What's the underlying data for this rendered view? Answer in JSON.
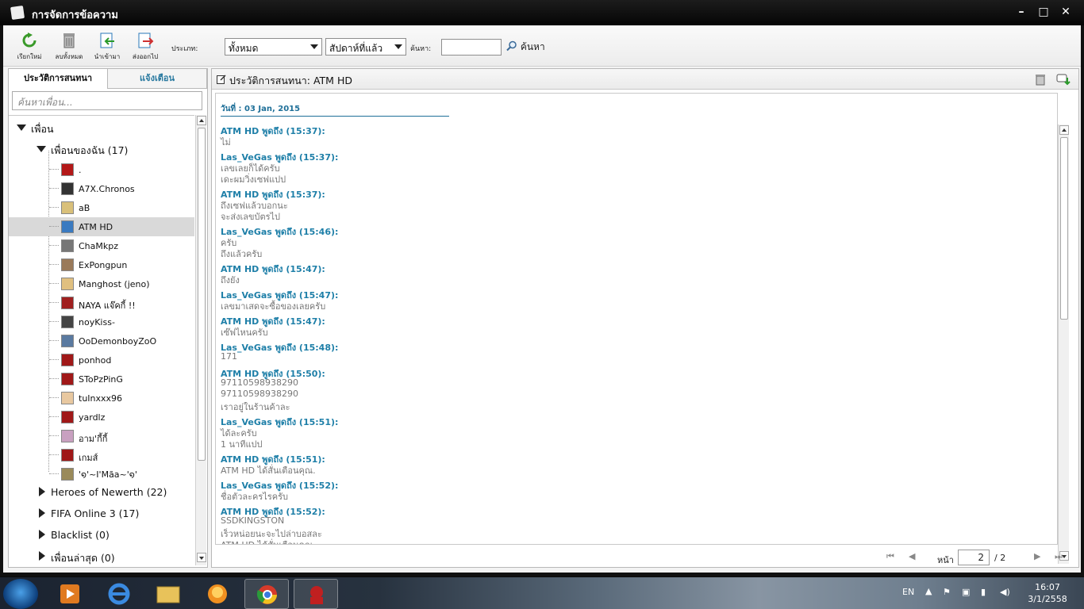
{
  "window": {
    "title": "การจัดการข้อความ"
  },
  "toolbar": {
    "buttons": [
      {
        "label": "เรียกใหม่"
      },
      {
        "label": "ลบทั้งหมด"
      },
      {
        "label": "นำเข้ามา"
      },
      {
        "label": "ส่งออกไป"
      }
    ],
    "type_label": "ประเภท:",
    "type_value": "ทั้งหมด",
    "period_value": "สัปดาห์ที่แล้ว",
    "search_label": "ค้นหา:",
    "search_button": "ค้นหา"
  },
  "left": {
    "tabs": [
      "ประวัติการสนทนา",
      "แจ้งเตือน"
    ],
    "search_placeholder": "ค้นหาเพื่อน...",
    "root": "เพื่อน",
    "my_friends": "เพื่อนของฉัน (17)",
    "friends": [
      ".",
      "A7X.Chronos",
      "aB",
      "ATM HD",
      "ChaMkpz",
      "ExPongpun",
      "Manghost (jeno)",
      "NAYA แจ๊คกี้ !!",
      "noyKiss-",
      "OoDemonboyZoO",
      "ponhod",
      "SToPzPinG",
      "tuInxxx96",
      "yardlz",
      "อาม'กี้กี้",
      "เกมส์",
      "'໑'~I'Mãa~'໑'"
    ],
    "selected_friend": "ATM HD",
    "groups": [
      "Heroes of Newerth (22)",
      "FIFA Online 3 (17)",
      "Blacklist (0)",
      "เพื่อนล่าสุด (0)"
    ]
  },
  "right": {
    "header": "ประวัติการสนทนา: ATM HD",
    "date": "วันที่ : 03 Jan, 2015",
    "messages": [
      {
        "head": "ATM HD พูดถึง  (15:37):",
        "lines": [
          "ไม่"
        ]
      },
      {
        "head": "Las_VeGas พูดถึง  (15:37):",
        "lines": [
          "เลขเลยก็ได้ครับ",
          "เดะผมวิ่งเซฟแปป"
        ]
      },
      {
        "head": "ATM HD พูดถึง  (15:37):",
        "lines": [
          "ถึงเซฟแล้วบอกนะ",
          "จะส่งเลขบัตรไป"
        ]
      },
      {
        "head": "Las_VeGas พูดถึง  (15:46):",
        "lines": [
          "ครับ",
          "ถึงแล้วครับ"
        ]
      },
      {
        "head": "ATM HD พูดถึง  (15:47):",
        "lines": [
          "ถึงยัง"
        ]
      },
      {
        "head": "Las_VeGas พูดถึง  (15:47):",
        "lines": [
          "เลขมาเสดจะซื้อของเลยครับ"
        ]
      },
      {
        "head": "ATM HD พูดถึง  (15:47):",
        "lines": [
          "เซ๊ฟไหนครับ"
        ]
      },
      {
        "head": "Las_VeGas พูดถึง  (15:48):",
        "lines": [
          "171"
        ]
      },
      {
        "head": "ATM HD พูดถึง  (15:50):",
        "lines": [
          "97110598938290",
          "97110598938290",
          "เราอยู่ในร้านค้าละ"
        ]
      },
      {
        "head": "Las_VeGas พูดถึง  (15:51):",
        "lines": [
          "ได้ละครับ",
          "1 นาทีแปป"
        ]
      },
      {
        "head": "ATM HD พูดถึง  (15:51):",
        "lines": [
          "ATM HD ได้สั่นเตือนคุณ."
        ]
      },
      {
        "head": "Las_VeGas พูดถึง  (15:52):",
        "lines": [
          "ชื่อตัวละครไรครับ"
        ]
      },
      {
        "head": "ATM HD พูดถึง  (15:52):",
        "lines": [
          "SSDKINGSTON",
          "เร็วหน่อยนะจะไปล่าบอสละ",
          "ATM HD ได้สั่นเตือนคุณ."
        ]
      }
    ],
    "pager": {
      "label": "หน้า",
      "current": "2",
      "total": "/ 2"
    }
  },
  "taskbar": {
    "lang": "EN",
    "time": "16:07",
    "date": "3/1/2558"
  },
  "colors": {
    "accent": "#1e7fa8",
    "message_text": "#777777",
    "selected_row": "#d9d9d9"
  }
}
